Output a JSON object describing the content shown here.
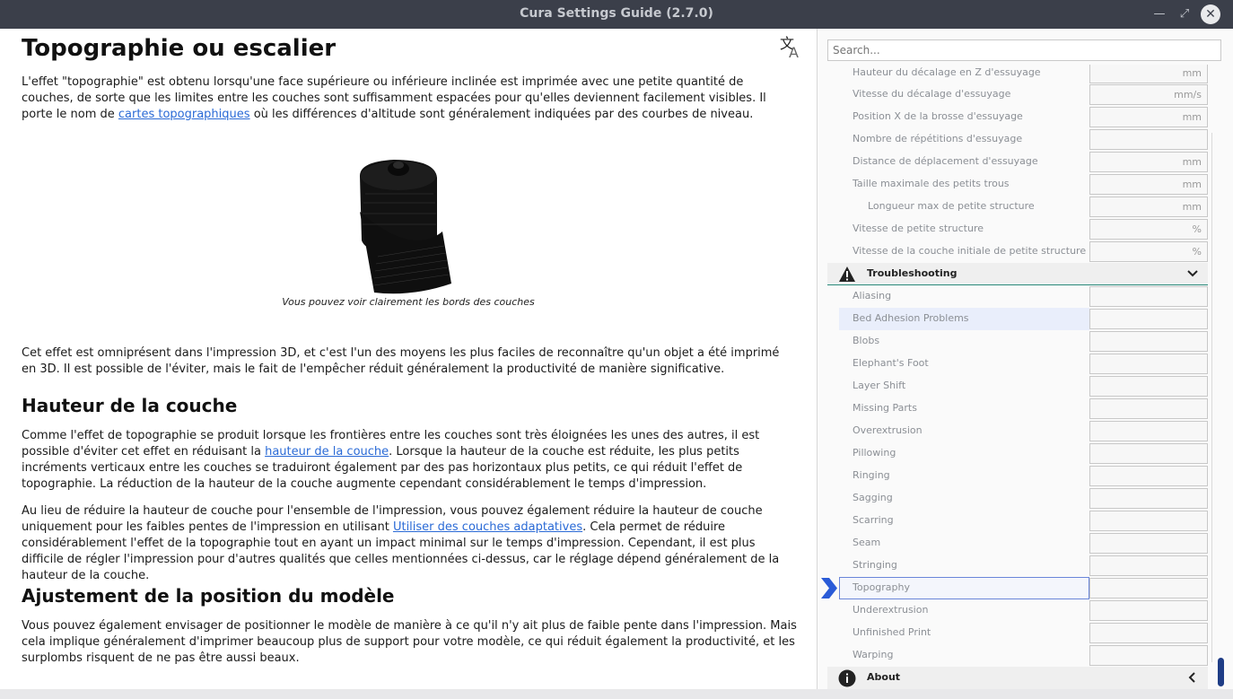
{
  "window": {
    "title": "Cura Settings Guide (2.7.0)",
    "minimize_glyph": "—",
    "maximize_glyph": "⤢",
    "close_glyph": "✕"
  },
  "article": {
    "title": "Topographie ou escalier",
    "intro_part1": "L'effet \"topographie\" est obtenu lorsqu'une face supérieure ou inférieure inclinée est imprimée avec une petite quantité de couches, de sorte que les limites entre les couches sont suffisamment espacées pour qu'elles deviennent facilement visibles. Il porte le nom de ",
    "intro_link": "cartes topographiques",
    "intro_part2": " où les différences d'altitude sont généralement indiquées par des courbes de niveau.",
    "figure_caption": "Vous pouvez voir clairement les bords des couches",
    "paragraph2": "Cet effet est omniprésent dans l'impression 3D, et c'est l'un des moyens les plus faciles de reconnaître qu'un objet a été imprimé en 3D. Il est possible de l'éviter, mais le fait de l'empêcher réduit généralement la productivité de manière significative.",
    "section1_title": "Hauteur de la couche",
    "section1_p1_part1": "Comme l'effet de topographie se produit lorsque les frontières entre les couches sont très éloignées les unes des autres, il est possible d'éviter cet effet en réduisant la ",
    "section1_p1_link": "hauteur de la couche",
    "section1_p1_part2": ". Lorsque la hauteur de la couche est réduite, les plus petits incréments verticaux entre les couches se traduiront également par des pas horizontaux plus petits, ce qui réduit l'effet de topographie. La réduction de la hauteur de la couche augmente cependant considérablement le temps d'impression.",
    "section1_p2_part1": "Au lieu de réduire la hauteur de couche pour l'ensemble de l'impression, vous pouvez également réduire la hauteur de couche uniquement pour les faibles pentes de l'impression en utilisant ",
    "section1_p2_link": "Utiliser des couches adaptatives",
    "section1_p2_part2": ". Cela permet de réduire considérablement l'effet de la topographie tout en ayant un impact minimal sur le temps d'impression. Cependant, il est plus difficile de régler l'impression pour d'autres qualités que celles mentionnées ci-dessus, car le réglage dépend généralement de la hauteur de la couche.",
    "section2_title": "Ajustement de la position du modèle",
    "section2_p1": "Vous pouvez également envisager de positionner le modèle de manière à ce qu'il n'y ait plus de faible pente dans l'impression. Mais cela implique généralement d'imprimer beaucoup plus de support pour votre modèle, ce qui réduit également la productivité, et les surplombs risquent de ne pas être aussi beaux."
  },
  "sidebar": {
    "search_placeholder": "Search...",
    "settings": [
      {
        "label": "Hauteur du décalage en Z d'essuyage",
        "unit": "mm"
      },
      {
        "label": "Vitesse du décalage d'essuyage",
        "unit": "mm/s"
      },
      {
        "label": "Position X de la brosse d'essuyage",
        "unit": "mm"
      },
      {
        "label": "Nombre de répétitions d'essuyage",
        "unit": ""
      },
      {
        "label": "Distance de déplacement d'essuyage",
        "unit": "mm"
      },
      {
        "label": "Taille maximale des petits trous",
        "unit": "mm"
      },
      {
        "label": "Longueur max de petite structure",
        "unit": "mm"
      },
      {
        "label": "Vitesse de petite structure",
        "unit": "%"
      },
      {
        "label": "Vitesse de la couche initiale de petite structure",
        "unit": "%"
      }
    ],
    "troubleshooting_label": "Troubleshooting",
    "troubleshooting_items": [
      "Aliasing",
      "Bed Adhesion Problems",
      "Blobs",
      "Elephant's Foot",
      "Layer Shift",
      "Missing Parts",
      "Overextrusion",
      "Pillowing",
      "Ringing",
      "Sagging",
      "Scarring",
      "Seam",
      "Stringing",
      "Topography",
      "Underextrusion",
      "Unfinished Print",
      "Warping"
    ],
    "about_label": "About",
    "colors": {
      "accent": "#2a5bd7",
      "selection_border": "#6a86d9",
      "hover_bg": "#e9eefb"
    }
  }
}
